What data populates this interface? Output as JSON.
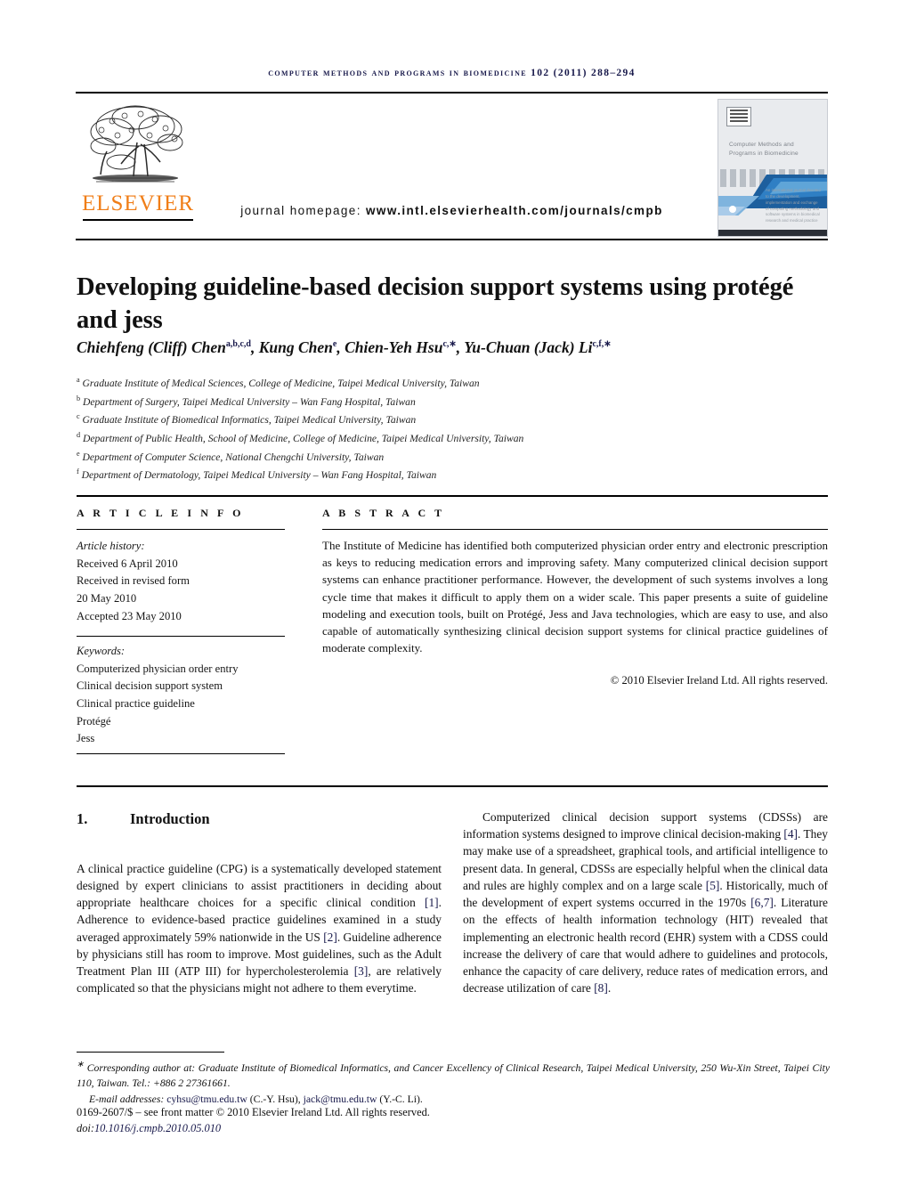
{
  "running_head": "Computer Methods and Programs in Biomedicine 102 (2011) 288–294",
  "masthead": {
    "publisher": "ELSEVIER",
    "homepage_label": "journal homepage:",
    "homepage_url": "www.intl.elsevierhealth.com/journals/cmpb",
    "cover_title": "Computer Methods and Programs in Biomedicine",
    "cover_footer": "An international journal devoted to the development, implementation and exchange of computing methodology and software systems in biomedical research and medical practice"
  },
  "article": {
    "title": "Developing guideline-based decision support systems using protégé and jess",
    "authors": [
      {
        "name": "Chiehfeng (Cliff) Chen",
        "marks": "a,b,c,d",
        "sep": ", "
      },
      {
        "name": "Kung Chen",
        "marks": "e",
        "sep": ", "
      },
      {
        "name": "Chien-Yeh Hsu",
        "marks": "c,∗",
        "sep": ", "
      },
      {
        "name": "Yu-Chuan (Jack) Li",
        "marks": "c,f,∗",
        "sep": ""
      }
    ],
    "affiliations": [
      {
        "mark": "a",
        "text": "Graduate Institute of Medical Sciences, College of Medicine, Taipei Medical University, Taiwan"
      },
      {
        "mark": "b",
        "text": "Department of Surgery, Taipei Medical University – Wan Fang Hospital, Taiwan"
      },
      {
        "mark": "c",
        "text": "Graduate Institute of Biomedical Informatics, Taipei Medical University, Taiwan"
      },
      {
        "mark": "d",
        "text": "Department of Public Health, School of Medicine, College of Medicine, Taipei Medical University, Taiwan"
      },
      {
        "mark": "e",
        "text": "Department of Computer Science, National Chengchi University, Taiwan"
      },
      {
        "mark": "f",
        "text": "Department of Dermatology, Taipei Medical University – Wan Fang Hospital, Taiwan"
      }
    ]
  },
  "info": {
    "heading": "A R T I C L E    I N F O",
    "history_label": "Article history:",
    "history": [
      "Received 6 April 2010",
      "Received in revised form",
      "20 May 2010",
      "Accepted 23 May 2010"
    ],
    "keywords_label": "Keywords:",
    "keywords": [
      "Computerized physician order entry",
      "Clinical decision support system",
      "Clinical practice guideline",
      "Protégé",
      "Jess"
    ]
  },
  "abstract": {
    "heading": "A B S T R A C T",
    "text": "The Institute of Medicine has identified both computerized physician order entry and electronic prescription as keys to reducing medication errors and improving safety. Many computerized clinical decision support systems can enhance practitioner performance. However, the development of such systems involves a long cycle time that makes it difficult to apply them on a wider scale. This paper presents a suite of guideline modeling and execution tools, built on Protégé, Jess and Java technologies, which are easy to use, and also capable of automatically synthesizing clinical decision support systems for clinical practice guidelines of moderate complexity.",
    "copyright": "© 2010 Elsevier Ireland Ltd. All rights reserved."
  },
  "body": {
    "section_number": "1.",
    "section_title": "Introduction",
    "left_paragraph": "A clinical practice guideline (CPG) is a systematically developed statement designed by expert clinicians to assist practitioners in deciding about appropriate healthcare choices for a specific clinical condition [1]. Adherence to evidence-based practice guidelines examined in a study averaged approximately 59% nationwide in the US [2]. Guideline adherence by physicians still has room to improve. Most guidelines, such as the Adult Treatment Plan III (ATP III) for hypercholesterolemia [3], are relatively complicated so that the physicians might not adhere to them everytime.",
    "right_paragraph": "Computerized clinical decision support systems (CDSSs) are information systems designed to improve clinical decision-making [4]. They may make use of a spreadsheet, graphical tools, and artificial intelligence to present data. In general, CDSSs are especially helpful when the clinical data and rules are highly complex and on a large scale [5]. Historically, much of the development of expert systems occurred in the 1970s [6,7]. Literature on the effects of health information technology (HIT) revealed that implementing an electronic health record (EHR) system with a CDSS could increase the delivery of care that would adhere to guidelines and protocols, enhance the capacity of care delivery, reduce rates of medication errors, and decrease utilization of care [8]."
  },
  "footnotes": {
    "corresponding": "Corresponding author at: Graduate Institute of Biomedical Informatics, and Cancer Excellency of Clinical Research, Taipei Medical University, 250 Wu-Xin Street, Taipei City 110, Taiwan. Tel.: +886 2 27361661.",
    "email_label": "E-mail addresses:",
    "email_1": "cyhsu@tmu.edu.tw",
    "email_1_owner": "(C.-Y. Hsu),",
    "email_2": "jack@tmu.edu.tw",
    "email_2_owner": "(Y.-C. Li).",
    "front_matter": "0169-2607/$ – see front matter © 2010 Elsevier Ireland Ltd. All rights reserved.",
    "doi_label": "doi:",
    "doi_value": "10.1016/j.cmpb.2010.05.010"
  }
}
